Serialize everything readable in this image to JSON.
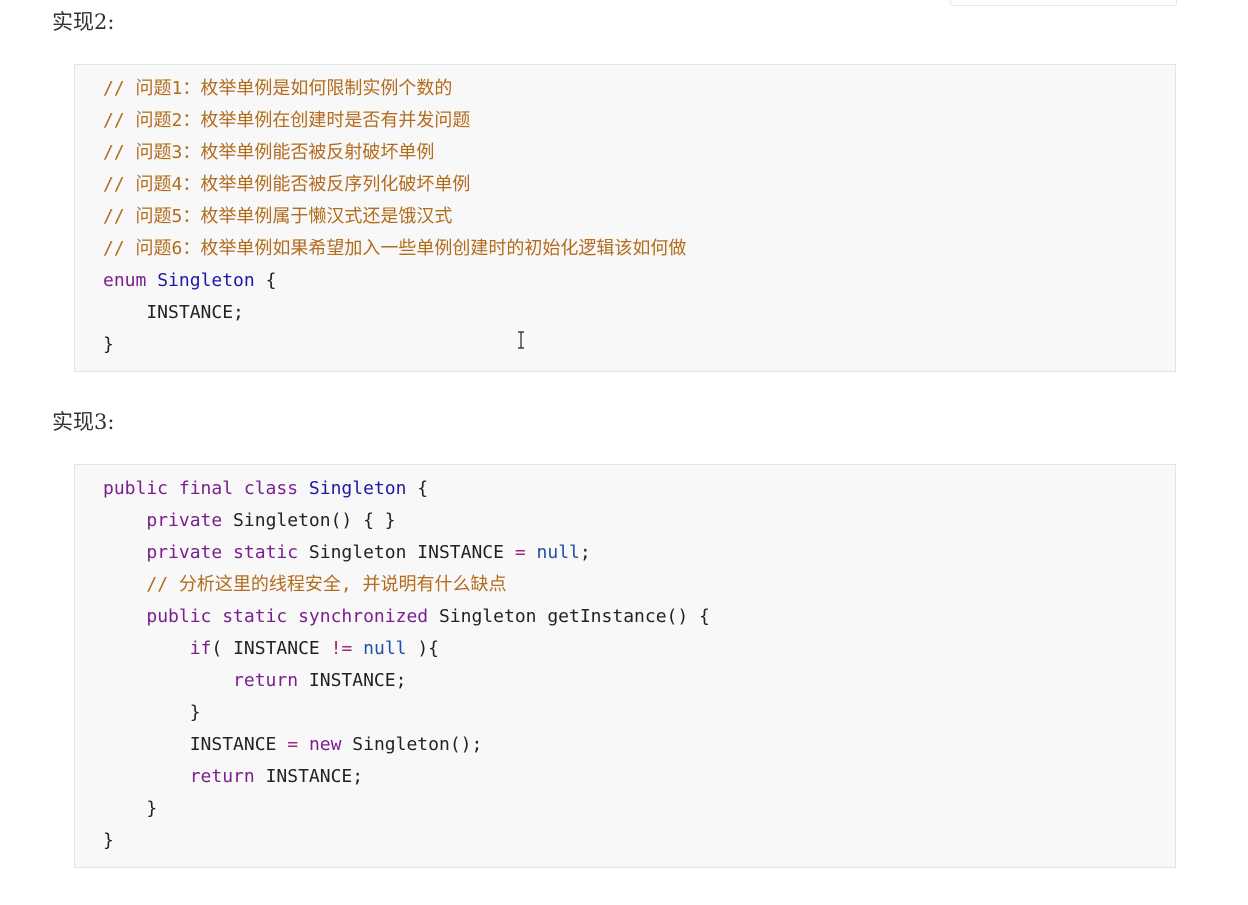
{
  "section2": {
    "heading": "实现2:",
    "lines": [
      "// 问题1：枚举单例是如何限制实例个数的",
      "// 问题2：枚举单例在创建时是否有并发问题",
      "// 问题3：枚举单例能否被反射破坏单例",
      "// 问题4：枚举单例能否被反序列化破坏单例",
      "// 问题5：枚举单例属于懒汉式还是饿汉式",
      "// 问题6：枚举单例如果希望加入一些单例创建时的初始化逻辑该如何做"
    ],
    "enum_kw": "enum",
    "enum_name": "Singleton",
    "brace_open": " {",
    "instance_line": "    INSTANCE;",
    "brace_close": "}"
  },
  "section3": {
    "heading": "实现3:",
    "l1": {
      "kw": "public final class",
      "name": "Singleton",
      "rest": " {"
    },
    "l2": {
      "indent": "    ",
      "kw": "private",
      "rest": " Singleton() { }"
    },
    "l3": {
      "indent": "    ",
      "kw": "private static",
      "mid": " Singleton INSTANCE ",
      "op": "=",
      "sp": " ",
      "lit": "null",
      "rest": ";"
    },
    "l4": {
      "indent": "    ",
      "comment": "// 分析这里的线程安全, 并说明有什么缺点"
    },
    "l5": {
      "indent": "    ",
      "kw": "public static synchronized",
      "rest": " Singleton getInstance() {"
    },
    "l6": {
      "indent": "        ",
      "kw": "if",
      "a": "( INSTANCE ",
      "op": "!=",
      "sp": " ",
      "lit": "null",
      "rest": " ){"
    },
    "l7": {
      "indent": "            ",
      "kw": "return",
      "rest": " INSTANCE;"
    },
    "l8": "        }",
    "l9": {
      "indent": "        ",
      "a": "INSTANCE ",
      "op": "=",
      "sp": " ",
      "kw": "new",
      "rest": " Singleton();"
    },
    "l10": {
      "indent": "        ",
      "kw": "return",
      "rest": " INSTANCE;"
    },
    "l11": "    }",
    "l12": "}"
  }
}
